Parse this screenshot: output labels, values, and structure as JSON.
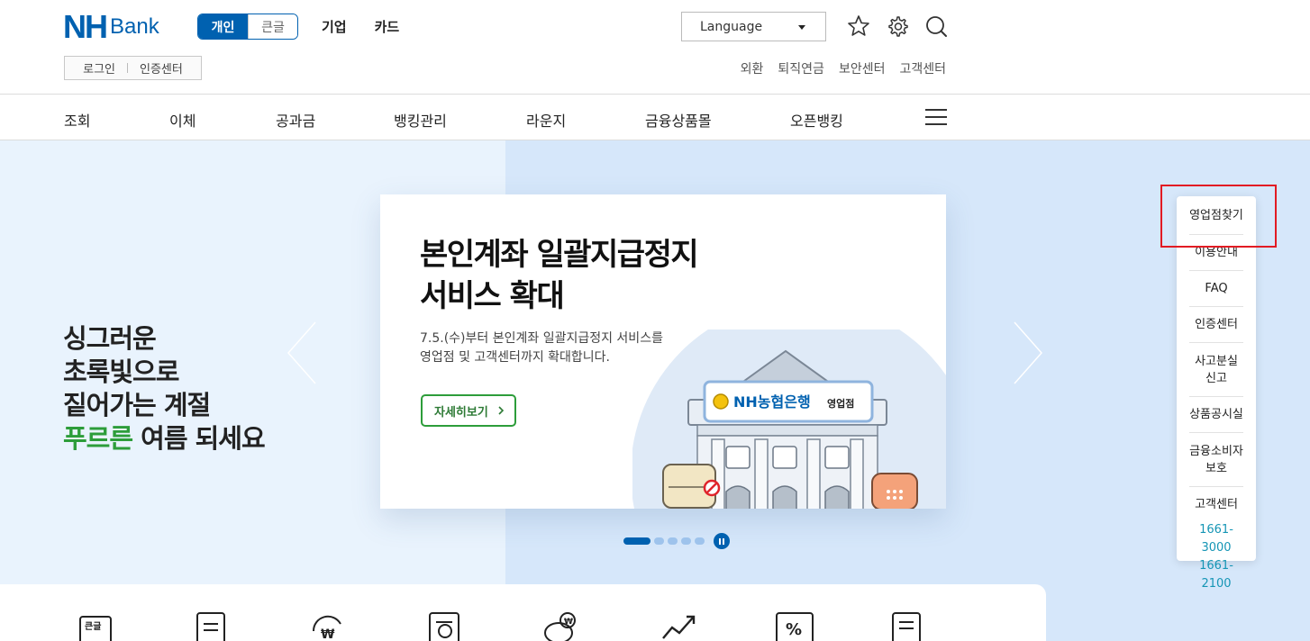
{
  "header": {
    "logo_nh": "NH",
    "logo_bank": "Bank",
    "segment": [
      "개인",
      "큰글"
    ],
    "biz_tabs": [
      "기업",
      "카드"
    ],
    "login": "로그인",
    "cert": "인증센터",
    "language": "Language",
    "util_links": [
      "외환",
      "퇴직연금",
      "보안센터",
      "고객센터"
    ]
  },
  "gnb": [
    "조회",
    "이체",
    "공과금",
    "뱅킹관리",
    "라운지",
    "금융상품몰",
    "오픈뱅킹"
  ],
  "hero": {
    "slogan": [
      "싱그러운",
      "초록빛으로",
      "짙어가는 계절"
    ],
    "slogan_green": "푸르른",
    "slogan_rest": " 여름 되세요",
    "card_title": [
      "본인계좌 일괄지급정지",
      "서비스 확대"
    ],
    "card_desc": [
      "7.5.(수)부터 본인계좌 일괄지급정지 서비스를",
      "영업점 및 고객센터까지 확대합니다."
    ],
    "card_button": "자세히보기",
    "sign_text": "NH농협은행",
    "sign_sub": "영업점",
    "accent_green": "#2d9d3a",
    "brand_blue": "#0061b0"
  },
  "pager": {
    "total": 5,
    "active": 1
  },
  "quick": [
    "영업점찾기",
    "이용안내",
    "FAQ",
    "인증센터",
    "사고분실\n신고",
    "상품공시실",
    "금융소비자\n보호",
    "고객센터"
  ],
  "quick_phones": [
    "1661-3000",
    "1661-2100"
  ],
  "bottom_icons": {
    "large_text_badge": "큰글",
    "won_symbol": "₩",
    "piggy_symbol": "₩",
    "percent_symbol": "%"
  }
}
